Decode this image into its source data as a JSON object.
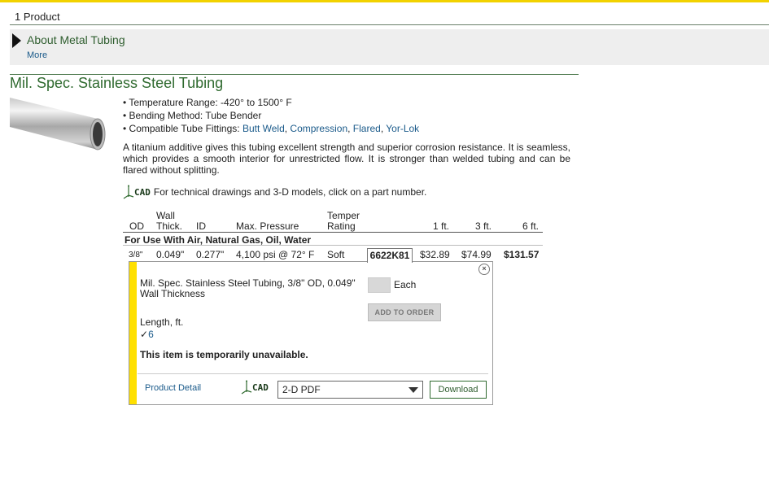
{
  "header": {
    "product_count": "1 Product"
  },
  "about": {
    "title": "About Metal Tubing",
    "more": "More"
  },
  "section": {
    "title": "Mil. Spec. Stainless Steel Tubing",
    "bullets": {
      "temp": "• Temperature Range: -420° to 1500° F",
      "bend": "• Bending Method: Tube Bender",
      "fittings_prefix": "• Compatible Tube Fittings: ",
      "fittings": [
        "Butt Weld",
        "Compression",
        "Flared",
        "Yor-Lok"
      ]
    },
    "description": "A titanium additive gives this tubing excellent strength and superior corrosion resistance. It is seamless, which provides a smooth interior for unrestricted flow. It is stronger than welded tubing and can be flared without splitting.",
    "cad_logo": "CAD",
    "cad_note": "For technical drawings and 3-D models, click on a part number."
  },
  "table": {
    "headers": {
      "od": "OD",
      "wall_1": "Wall",
      "wall_2": "Thick.",
      "id": "ID",
      "pressure": "Max. Pressure",
      "temper_1": "Temper",
      "temper_2": "Rating",
      "p1": "1 ft.",
      "p3": "3 ft.",
      "p6": "6 ft."
    },
    "group": "For Use With Air, Natural Gas, Oil, Water",
    "row": {
      "od": "3/8\"",
      "wall": "0.049\"",
      "id": "0.277\"",
      "pressure": "4,100 psi @ 72° F",
      "temper": "Soft",
      "part": "6622K81",
      "p1": "$32.89",
      "p3": "$74.99",
      "p6": "$131.57"
    }
  },
  "popup": {
    "description": "Mil. Spec. Stainless Steel Tubing, 3/8\" OD, 0.049\" Wall Thickness",
    "qty_unit": "Each",
    "add_to_order": "ADD TO ORDER",
    "length_label": "Length, ft.",
    "length_value": "6",
    "check": "✓",
    "unavailable": "This item is temporarily unavailable.",
    "product_detail": "Product Detail",
    "cad_logo": "CAD",
    "format_selected": "2-D PDF",
    "download": "Download",
    "close": "×"
  },
  "colors": {
    "accent_yellow": "#ffe000",
    "title_green": "#2f6a2f",
    "link_blue": "#1a5a8a"
  }
}
